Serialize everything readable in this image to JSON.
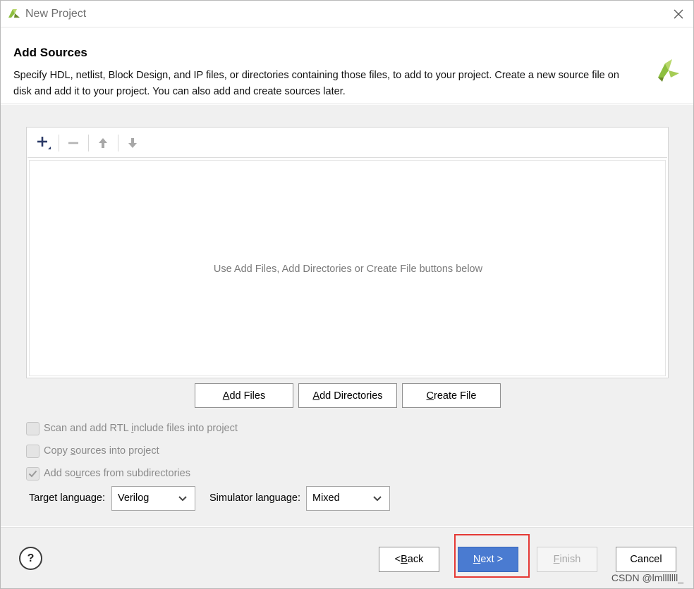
{
  "window": {
    "title": "New Project"
  },
  "header": {
    "title": "Add Sources",
    "description": "Specify HDL, netlist, Block Design, and IP files, or directories containing those files, to add to your project. Create a new source file on disk and add it to your project. You can also add and create sources later."
  },
  "sources_panel": {
    "empty_hint": "Use Add Files, Add Directories or Create File buttons below"
  },
  "action_buttons": {
    "add_files": {
      "mnemonic": "A",
      "rest": "dd Files"
    },
    "add_directories": {
      "mnemonic": "A",
      "rest": "dd Directories"
    },
    "create_file": {
      "mnemonic": "C",
      "rest": "reate File"
    }
  },
  "options": {
    "scan_rtl": {
      "before": "Scan and add RTL ",
      "mnemonic": "i",
      "after": "nclude files into project",
      "checked": false
    },
    "copy_sources": {
      "before": "Copy ",
      "mnemonic": "s",
      "after": "ources into project",
      "checked": false
    },
    "add_subdirs": {
      "before": "Add so",
      "mnemonic": "u",
      "after": "rces from subdirectories",
      "checked": true
    }
  },
  "languages": {
    "target_label": "Target language:",
    "target_value": "Verilog",
    "simulator_label": "Simulator language:",
    "simulator_value": "Mixed"
  },
  "footer": {
    "help": "?",
    "back": {
      "before": "< ",
      "mnemonic": "B",
      "after": "ack"
    },
    "next": {
      "mnemonic": "N",
      "after": "ext >"
    },
    "finish": {
      "mnemonic": "F",
      "after": "inish"
    },
    "cancel": "Cancel"
  },
  "watermark": "CSDN @lmlllllll_",
  "colors": {
    "accent_button": "#4a7bd1",
    "highlight_box": "#e53935",
    "logo_green": "#8dbf3f",
    "logo_dark": "#6a8a2a"
  }
}
